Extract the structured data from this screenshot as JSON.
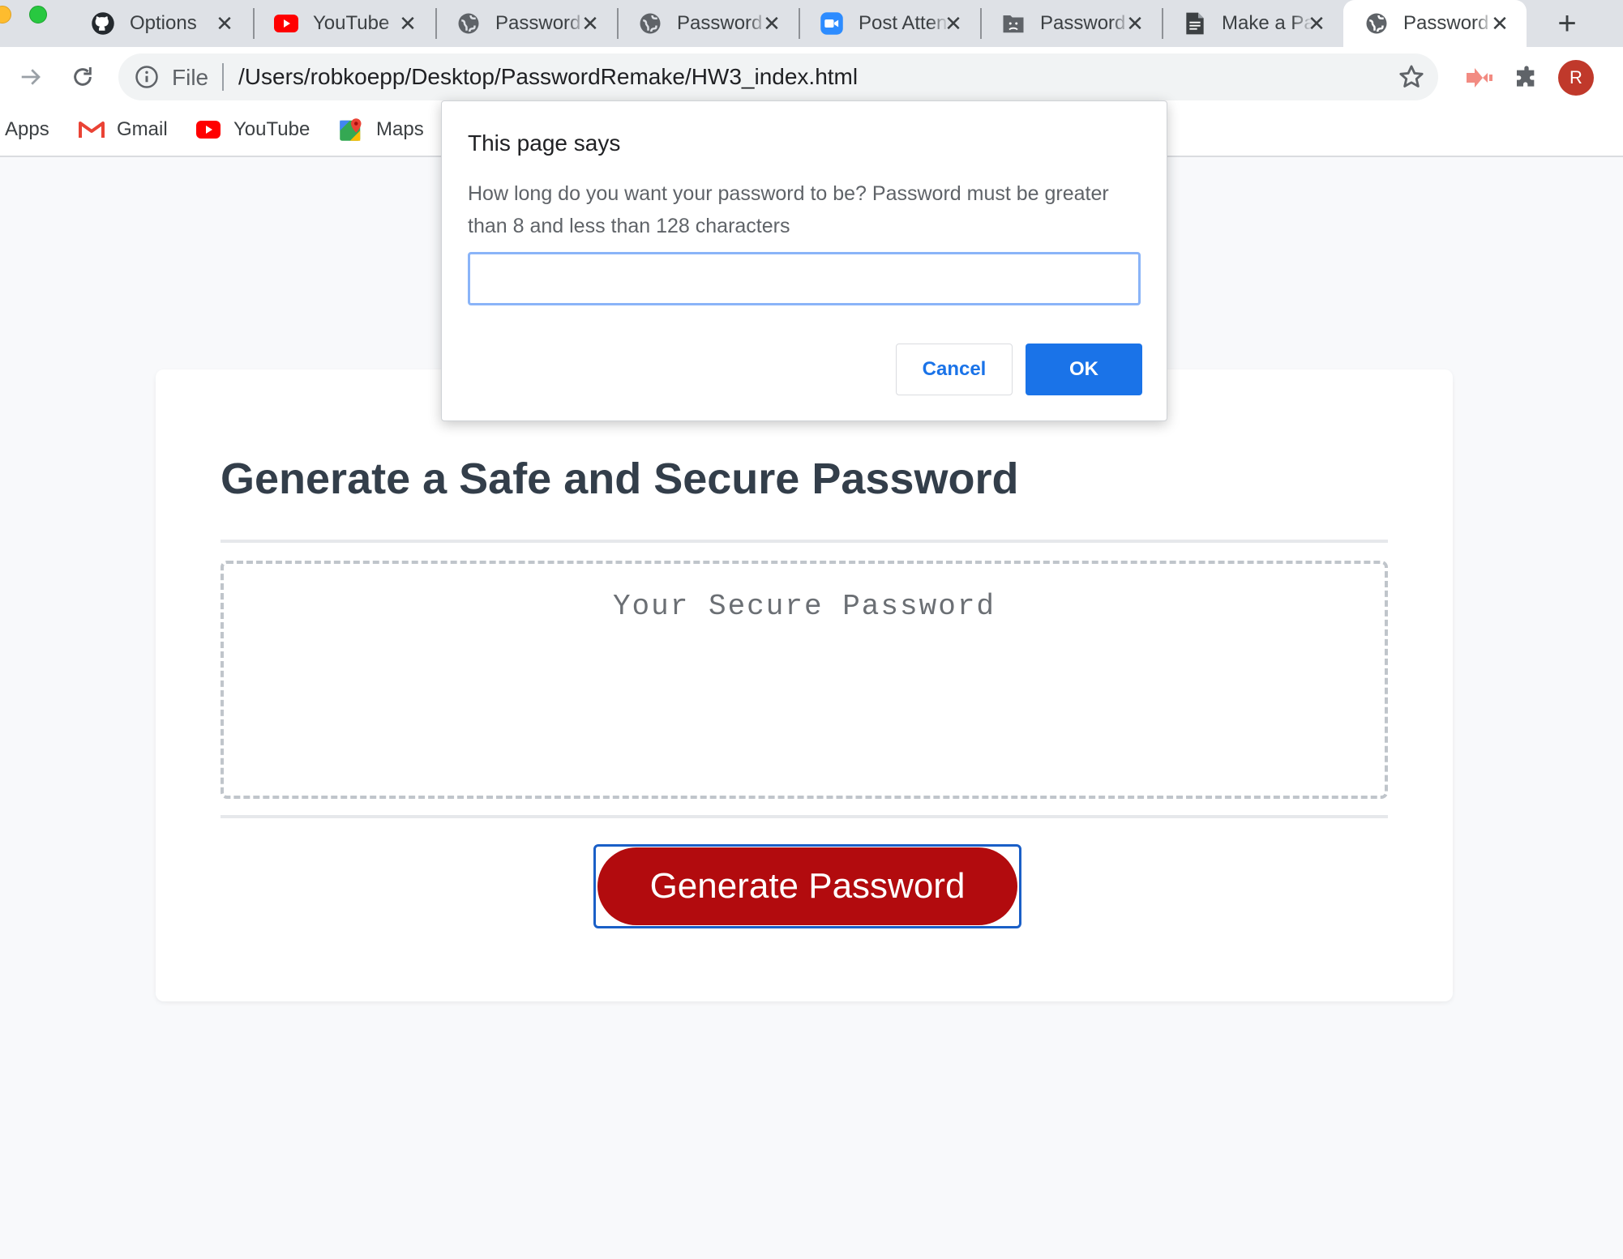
{
  "browser": {
    "tabs": [
      {
        "title": "Options",
        "icon": "github-icon"
      },
      {
        "title": "YouTube",
        "icon": "youtube-icon"
      },
      {
        "title": "Password",
        "icon": "globe-icon"
      },
      {
        "title": "Password",
        "icon": "globe-icon"
      },
      {
        "title": "Post Attendee",
        "icon": "zoom-icon"
      },
      {
        "title": "Password",
        "icon": "sad-folder-icon"
      },
      {
        "title": "Make a Password",
        "icon": "document-icon"
      },
      {
        "title": "Password",
        "icon": "globe-icon",
        "active": true
      }
    ],
    "close_glyph": "✕",
    "new_tab_glyph": "+",
    "address": {
      "scheme_label": "File",
      "url": "/Users/robkoepp/Desktop/PasswordRemake/HW3_index.html"
    },
    "profile_initial": "R",
    "bookmarks": [
      {
        "label": "Apps",
        "icon": "apps-grid-icon"
      },
      {
        "label": "Gmail",
        "icon": "gmail-icon"
      },
      {
        "label": "YouTube",
        "icon": "youtube-icon"
      },
      {
        "label": "Maps",
        "icon": "maps-icon"
      }
    ]
  },
  "page": {
    "title": "Generate a Safe and Secure Password",
    "password_placeholder": "Your Secure Password",
    "generate_label": "Generate Password"
  },
  "dialog": {
    "title": "This page says",
    "message": "How long do you want your password to be? Password must be greater than 8 and less than 128 characters",
    "input_value": "",
    "cancel_label": "Cancel",
    "ok_label": "OK"
  },
  "colors": {
    "accent_blue": "#1a73e8",
    "generate_red": "#b20b0e",
    "heading": "#333e4a"
  }
}
